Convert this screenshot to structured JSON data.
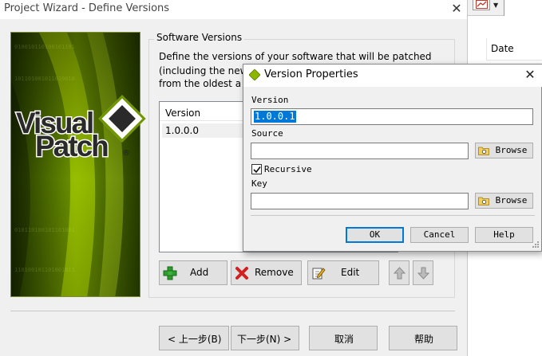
{
  "wizard": {
    "title": "Project Wizard - Define Versions",
    "close_glyph": "✕",
    "group_title": "Software Versions",
    "description": [
      "Define the versions of your software that will be patched",
      "(including the new",
      "from the  oldest a"
    ],
    "list": {
      "header": "Version",
      "rows": [
        "1.0.0.0"
      ]
    },
    "buttons": {
      "add": "Add",
      "remove": "Remove",
      "edit": "Edit"
    },
    "nav": {
      "back": "< 上一步(B)",
      "next": "下一步(N) >",
      "cancel": "取消",
      "help": "帮助"
    }
  },
  "background": {
    "date_header": "Date"
  },
  "dialog": {
    "title": "Version Properties",
    "close_glyph": "✕",
    "version_label": "Version",
    "version_value": "1.0.0.1",
    "source_label": "Source",
    "source_value": "",
    "recursive_label": "Recursive",
    "recursive_checked": true,
    "key_label": "Key",
    "key_value": "",
    "browse_label": "Browse",
    "ok": "OK",
    "cancel": "Cancel",
    "help": "Help"
  },
  "logo": {
    "line1": "Visual",
    "line2": "Patch",
    "mark": "®"
  },
  "colors": {
    "banner_green": "#8db600",
    "logo_green": "#9bc400",
    "selection": "#0078d7",
    "add_icon": "#2e9b2e",
    "remove_icon": "#d22020"
  }
}
